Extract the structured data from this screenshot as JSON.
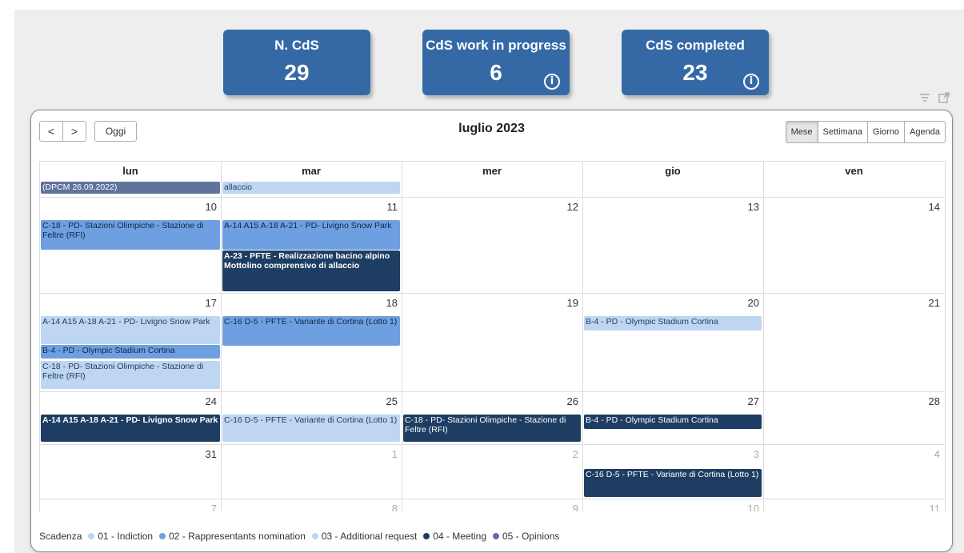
{
  "kpis": [
    {
      "title": "N. CdS",
      "value": "29"
    },
    {
      "title": "CdS work in progress",
      "value": "6",
      "info": "i"
    },
    {
      "title": "CdS completed",
      "value": "23",
      "info": "i"
    }
  ],
  "visual_icons": [
    "filter-icon",
    "focus-mode-icon"
  ],
  "calendar": {
    "prev": "<",
    "next": ">",
    "today": "Oggi",
    "title": "luglio 2023",
    "views": [
      "Mese",
      "Settimana",
      "Giorno",
      "Agenda"
    ],
    "active_view": "Mese",
    "weekdays": [
      "lun",
      "mar",
      "mer",
      "gio",
      "ven"
    ],
    "week1_events": {
      "lun": "(DPCM 26.09.2022)",
      "mar": "allaccio"
    },
    "weeks": [
      {
        "days": [
          "10",
          "11",
          "12",
          "13",
          "14"
        ]
      },
      {
        "days": [
          "17",
          "18",
          "19",
          "20",
          "21"
        ]
      },
      {
        "days": [
          "24",
          "25",
          "26",
          "27",
          "28"
        ]
      },
      {
        "days": [
          "31",
          "1",
          "2",
          "3",
          "4"
        ]
      },
      {
        "days": [
          "7",
          "8",
          "9",
          "10",
          "11"
        ]
      }
    ],
    "events": {
      "w2_lun": "C-18 - PD- Stazioni Olimpiche - Stazione di Feltre (RFI)",
      "w2_mar_1": "A-14 A15 A-18 A-21 - PD- Livigno Snow Park",
      "w2_mar_2": "A-23 - PFTE - Realizzazione bacino alpino Mottolino comprensivo di allaccio",
      "w3_lun_1": "A-14 A15 A-18 A-21 - PD- Livigno Snow Park",
      "w3_lun_2": "B-4 - PD - Olympic Stadium Cortina",
      "w3_lun_3": "C-18 - PD- Stazioni Olimpiche - Stazione di Feltre (RFI)",
      "w3_mar": "C-16 D-5 - PFTE - Variante di Cortina (Lotto 1)",
      "w3_gio": "B-4 - PD - Olympic Stadium Cortina",
      "w4_lun": "A-14 A15 A-18 A-21 - PD- Livigno Snow Park",
      "w4_mar": "C-16 D-5 - PFTE - Variante di Cortina (Lotto 1)",
      "w4_mer": "C-18 - PD- Stazioni Olimpiche - Stazione di Feltre (RFI)",
      "w4_gio": "B-4 - PD - Olympic Stadium Cortina",
      "w5_gio": "C-16 D-5 - PFTE - Variante di Cortina (Lotto 1)"
    }
  },
  "legend": {
    "title": "Scadenza",
    "items": [
      {
        "label": "01 - Indiction",
        "color": "#bed6f2"
      },
      {
        "label": "02 - Rappresentants nomination",
        "color": "#6e9fe0"
      },
      {
        "label": "03 - Additional request",
        "color": "#bed6f2"
      },
      {
        "label": "04 - Meeting",
        "color": "#1e3d63"
      },
      {
        "label": "05 - Opinions",
        "color": "#5f739c"
      }
    ]
  }
}
